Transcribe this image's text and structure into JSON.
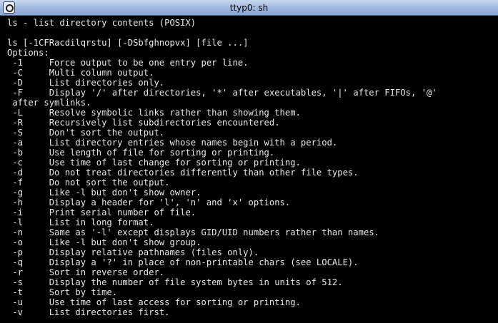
{
  "window": {
    "title": "ttyp0: sh",
    "icon": "window-menu-icon"
  },
  "terminal_lines": [
    "ls - list directory contents (POSIX)",
    "",
    "ls [-1CFRacdilqrstu] [-DSbfghnopvx] [file ...]",
    "Options:",
    " -1     Force output to be one entry per line.",
    " -C     Multi column output.",
    " -D     List directories only.",
    " -F     Display '/' after directories, '*' after executables, '|' after FIFOs, '@'",
    " after symlinks.",
    " -L     Resolve symbolic links rather than showing them.",
    " -R     Recursively list subdirectories encountered.",
    " -S     Don't sort the output.",
    " -a     List directory entries whose names begin with a period.",
    " -b     Use length of file for sorting or printing.",
    " -c     Use time of last change for sorting or printing.",
    " -d     Do not treat directories differently than other file types.",
    " -f     Do not sort the output.",
    " -g     Like -l but don't show owner.",
    " -h     Display a header for 'l', 'n' and 'x' options.",
    " -i     Print serial number of file.",
    " -l     List in long format.",
    " -n     Same as '-l' except displays GID/UID numbers rather than names.",
    " -o     Like -l but don't show group.",
    " -p     Display relative pathnames (files only).",
    " -q     Display a '?' in place of non-printable chars (see LOCALE).",
    " -r     Sort in reverse order.",
    " -s     Display the number of file system bytes in units of 512.",
    " -t     Sort by time.",
    " -u     Use time of last access for sorting or printing.",
    " -v     List directories first."
  ]
}
